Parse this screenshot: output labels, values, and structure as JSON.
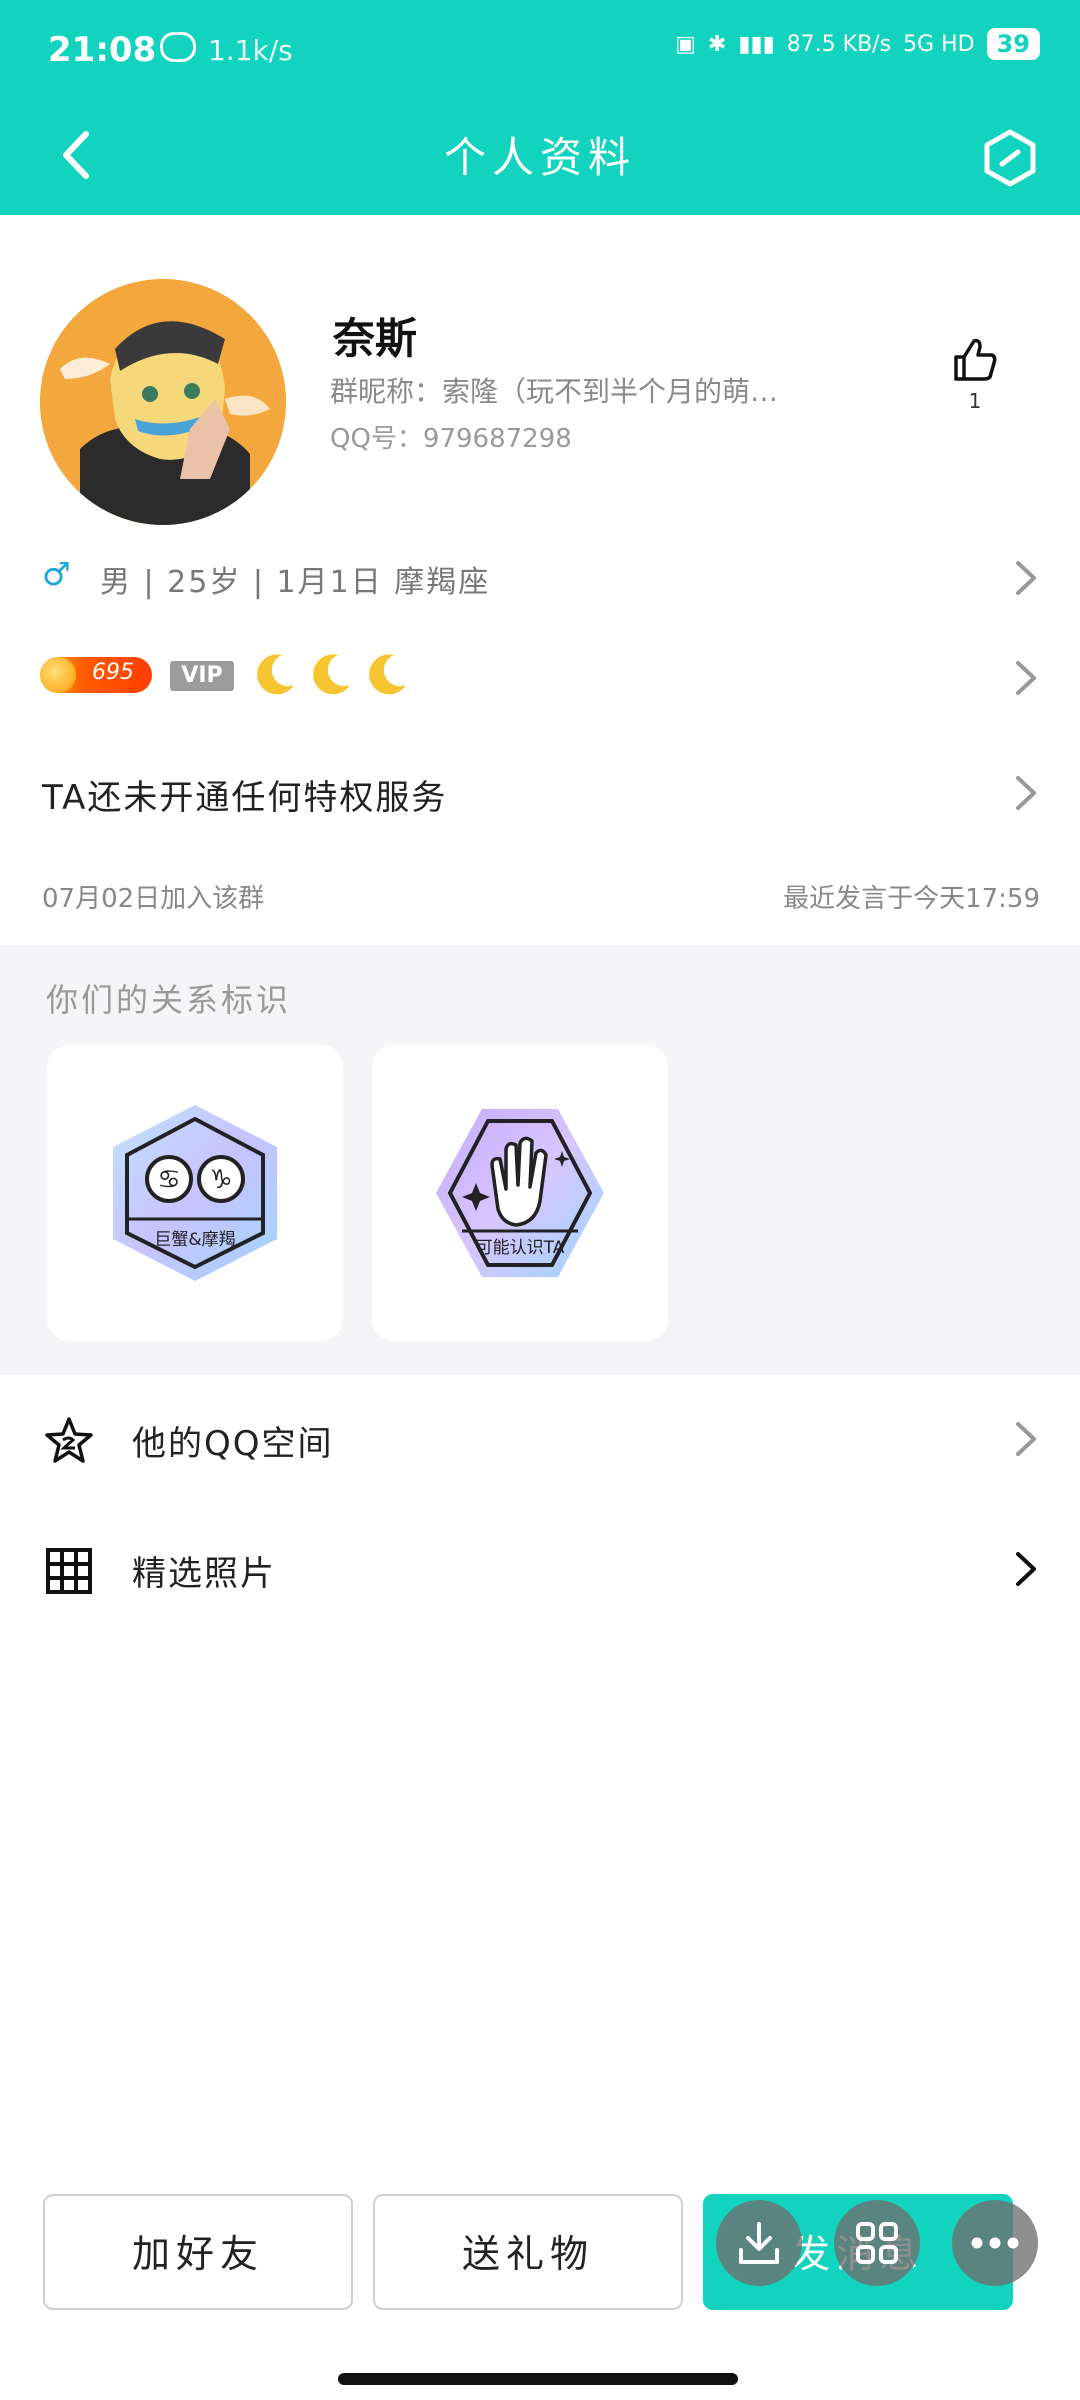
{
  "status": {
    "time": "21:08",
    "speed": "1.1k/s",
    "net": "87.5 KB/s",
    "network": "5G HD",
    "battery": "39"
  },
  "nav": {
    "title": "个人资料"
  },
  "profile": {
    "name": "奈斯",
    "nickname": "群昵称：索隆（玩不到半个月的萌…",
    "qq": "QQ号：979687298",
    "likes": "1"
  },
  "info": {
    "gender_symbol": "♂",
    "text": "男 | 25岁 | 1月1日  摩羯座"
  },
  "level": {
    "points": "695",
    "vip": "VIP"
  },
  "privilege": {
    "text": "TA还未开通任何特权服务"
  },
  "join": {
    "joined": "07月02日加入该群",
    "last_speak": "最近发言于今天17:59"
  },
  "relation": {
    "title": "你们的关系标识",
    "badges": [
      {
        "label": "巨蟹&摩羯"
      },
      {
        "label": "可能认识TA"
      }
    ]
  },
  "menu": {
    "qzone": "他的QQ空间",
    "photos": "精选照片"
  },
  "actions": {
    "add_friend": "加好友",
    "send_gift": "送礼物",
    "send_message": "发消息"
  },
  "colors": {
    "accent": "#12D3BE",
    "background": "#ffffff",
    "section": "#f5f4f6"
  }
}
